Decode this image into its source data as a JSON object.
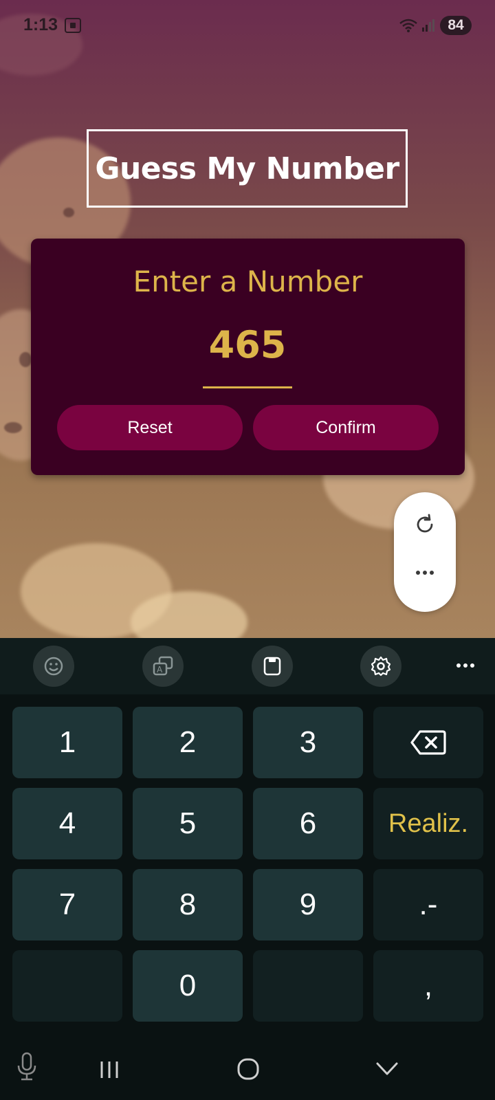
{
  "status_bar": {
    "time": "1:13",
    "battery": "84",
    "icons": [
      "screenshot-icon",
      "wifi-icon",
      "signal-icon"
    ]
  },
  "app": {
    "title": "Guess My Number",
    "card": {
      "heading": "Enter a Number",
      "input_value": "465",
      "reset_label": "Reset",
      "confirm_label": "Confirm"
    },
    "colors": {
      "card_bg": "#3a0022",
      "accent": "#ddb44a",
      "button_bg": "#7a0340"
    }
  },
  "floating_panel": {
    "icons": [
      "refresh-icon",
      "more-icon"
    ]
  },
  "keyboard": {
    "toolbar_icons": [
      "emoji-icon",
      "translate-icon",
      "clipboard-icon",
      "settings-icon",
      "more-icon"
    ],
    "keys": {
      "k1": "1",
      "k2": "2",
      "k3": "3",
      "k4": "4",
      "k5": "5",
      "k6": "6",
      "k7": "7",
      "k8": "8",
      "k9": "9",
      "k0": "0",
      "done": "Realiz.",
      "dot_minus": ".-",
      "comma": ","
    },
    "colors": {
      "key_bg": "#1e3537",
      "done_text": "#e0c14a"
    }
  },
  "nav_bar": {
    "icons": [
      "microphone-icon",
      "recent-apps-icon",
      "home-icon",
      "hide-keyboard-icon"
    ]
  }
}
